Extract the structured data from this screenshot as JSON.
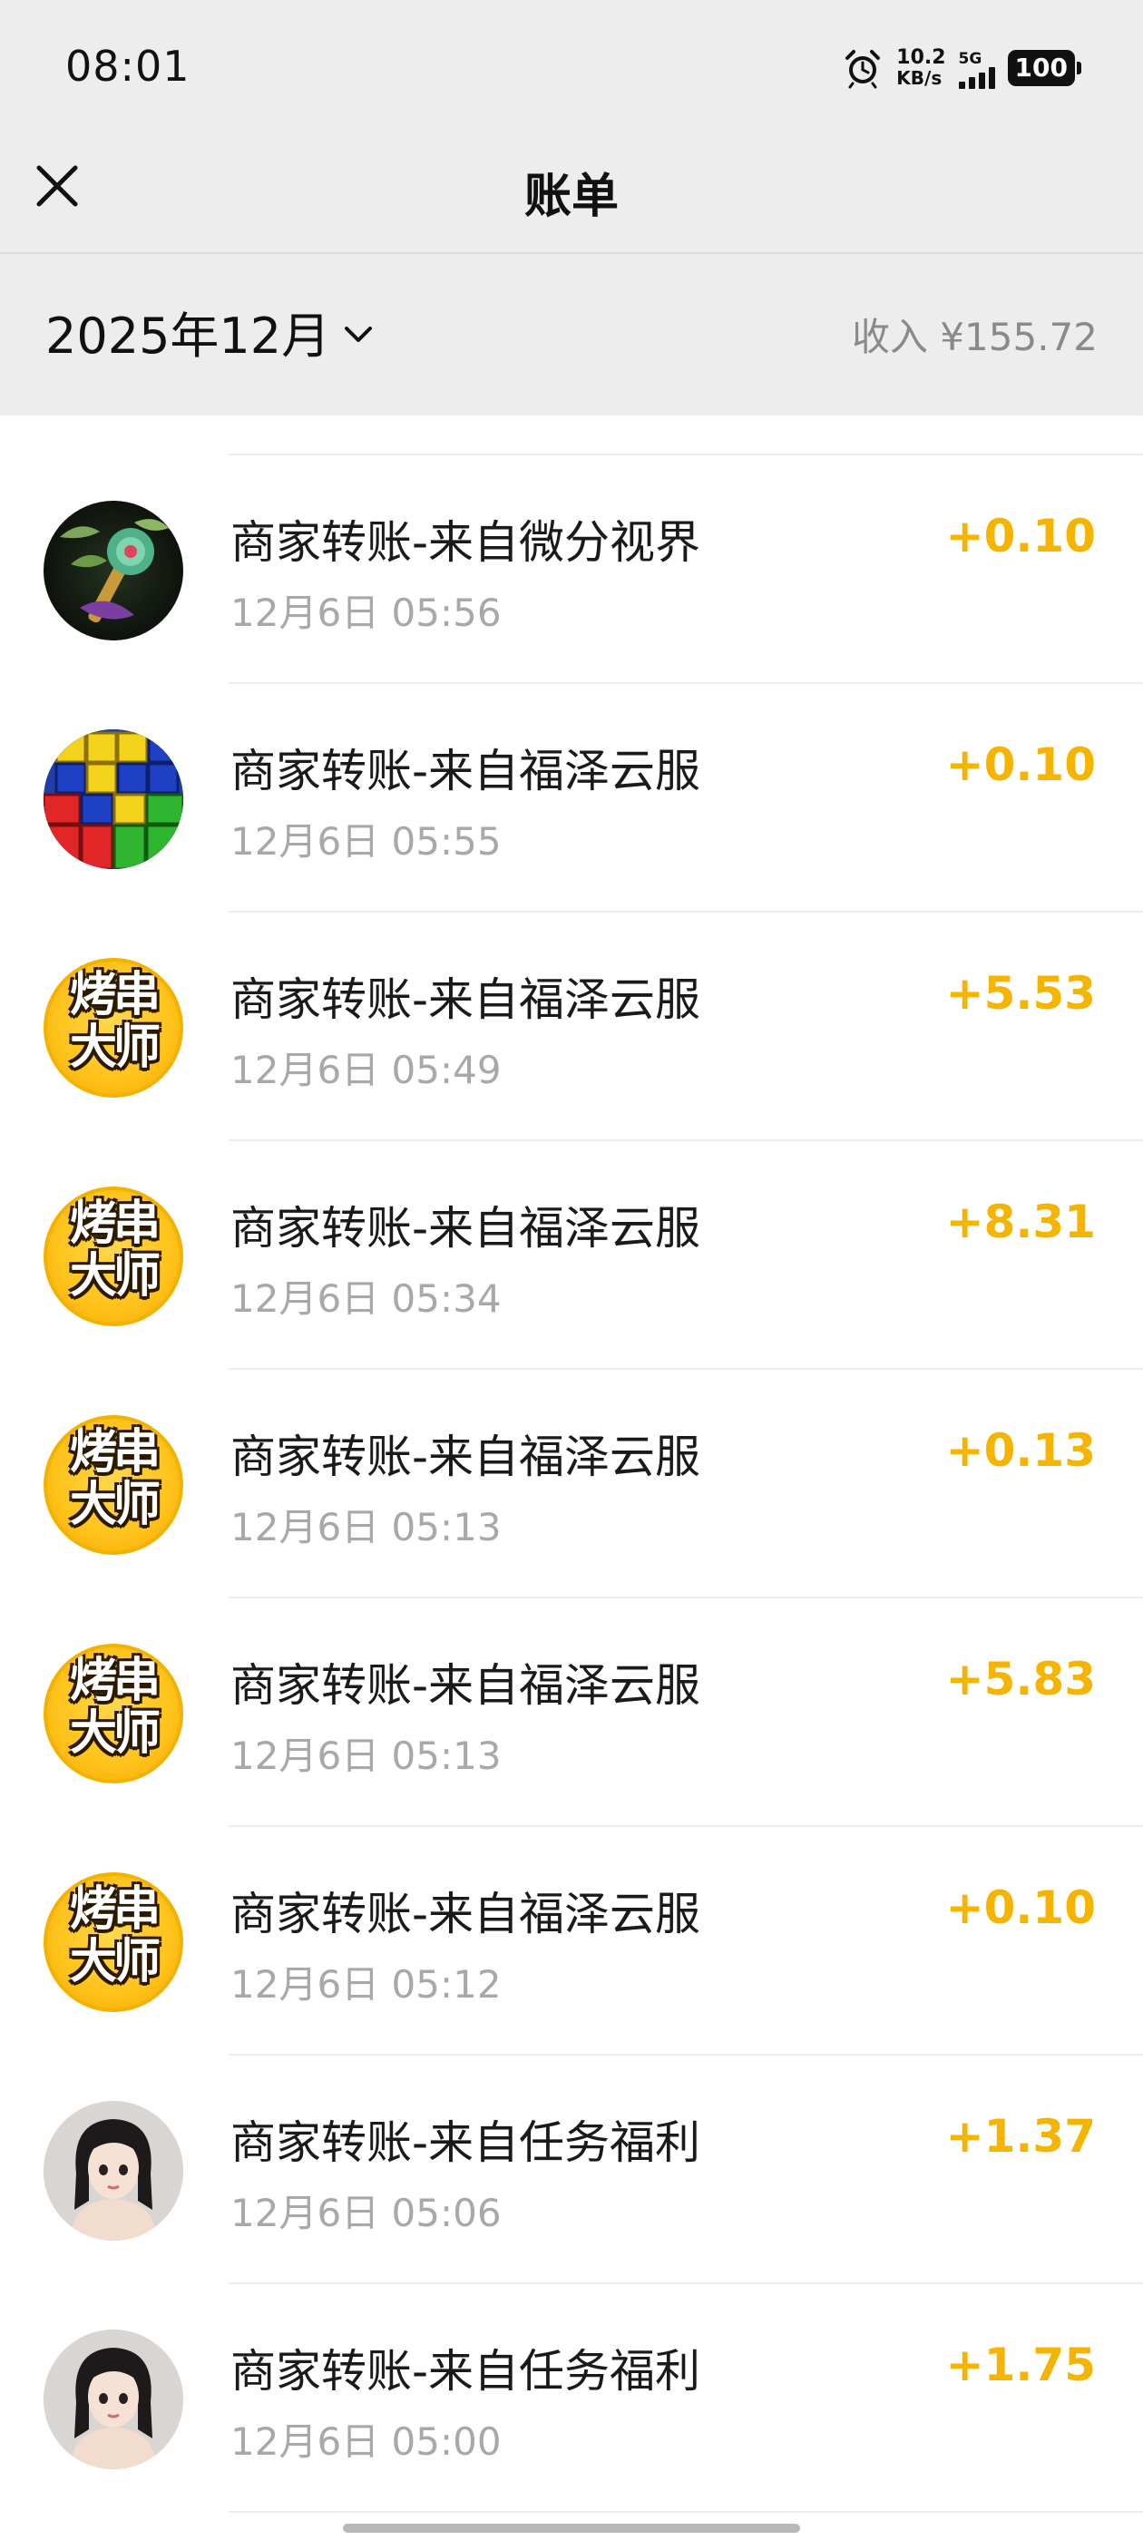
{
  "status_bar": {
    "time": "08:01",
    "net_speed_value": "10.2",
    "net_speed_unit": "KB/s",
    "network": "5G",
    "battery": "100"
  },
  "nav": {
    "title": "账单",
    "close_icon": "close-icon"
  },
  "filter": {
    "month": "2025年12月",
    "income_summary": "收入 ¥155.72"
  },
  "transactions": [
    {
      "title": "商家转账-来自微分视界",
      "time": "12月6日 05:56",
      "amount": "+0.10",
      "avatar": "jade-scepter-avatar"
    },
    {
      "title": "商家转账-来自福泽云服",
      "time": "12月6日 05:55",
      "amount": "+0.10",
      "avatar": "color-blocks-avatar"
    },
    {
      "title": "商家转账-来自福泽云服",
      "time": "12月6日 05:49",
      "amount": "+5.53",
      "avatar": "kaochuan-dashi-avatar"
    },
    {
      "title": "商家转账-来自福泽云服",
      "time": "12月6日 05:34",
      "amount": "+8.31",
      "avatar": "kaochuan-dashi-avatar"
    },
    {
      "title": "商家转账-来自福泽云服",
      "time": "12月6日 05:13",
      "amount": "+0.13",
      "avatar": "kaochuan-dashi-avatar"
    },
    {
      "title": "商家转账-来自福泽云服",
      "time": "12月6日 05:13",
      "amount": "+5.83",
      "avatar": "kaochuan-dashi-avatar"
    },
    {
      "title": "商家转账-来自福泽云服",
      "time": "12月6日 05:12",
      "amount": "+0.10",
      "avatar": "kaochuan-dashi-avatar"
    },
    {
      "title": "商家转账-来自任务福利",
      "time": "12月6日 05:06",
      "amount": "+1.37",
      "avatar": "girl-portrait-avatar"
    },
    {
      "title": "商家转账-来自任务福利",
      "time": "12月6日 05:00",
      "amount": "+1.75",
      "avatar": "girl-portrait-avatar"
    }
  ],
  "avatar_logo_text": {
    "kaochuan_line1": "烤串",
    "kaochuan_line2": "大师"
  },
  "colors": {
    "header_bg": "#ededed",
    "amount": "#f5b400",
    "secondary_text": "#a8a8a8"
  }
}
